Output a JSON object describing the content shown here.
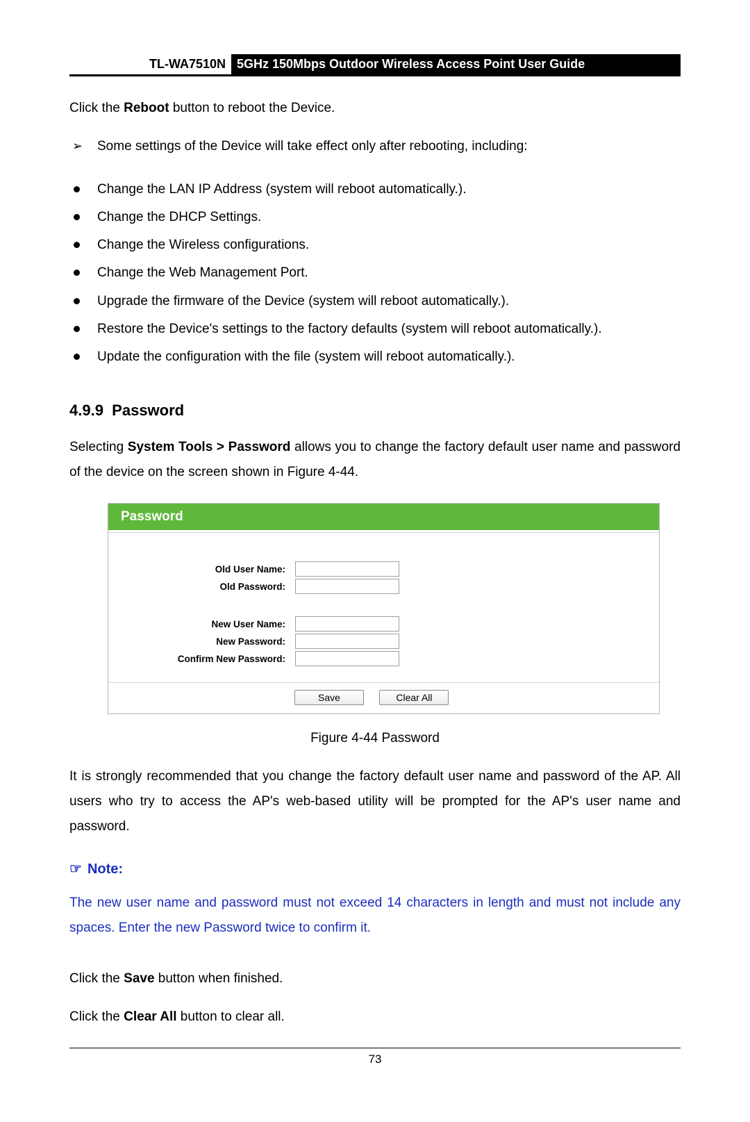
{
  "header": {
    "model": "TL-WA7510N",
    "title": "5GHz 150Mbps Outdoor Wireless Access Point User Guide"
  },
  "intro": {
    "pre": "Click the ",
    "bold": "Reboot",
    "post": " button to reboot the Device."
  },
  "arrow_item": "Some settings of the Device will take effect only after rebooting, including:",
  "bullets": [
    "Change the LAN IP Address (system will reboot automatically.).",
    "Change the DHCP Settings.",
    "Change the Wireless configurations.",
    "Change the Web Management Port.",
    "Upgrade the firmware of the Device (system will reboot automatically.).",
    "Restore the Device's settings to the factory defaults (system will reboot automatically.).",
    "Update the configuration with the file (system will reboot automatically.)."
  ],
  "section": {
    "number": "4.9.9",
    "title": "Password"
  },
  "section_intro": {
    "pre": "Selecting ",
    "bold": "System Tools > Password",
    "post": " allows you to change the factory default user name and password of the device on the screen shown in Figure 4-44."
  },
  "figure": {
    "title": "Password",
    "fields": {
      "old_user": "Old User Name:",
      "old_pass": "Old Password:",
      "new_user": "New User Name:",
      "new_pass": "New Password:",
      "confirm": "Confirm New Password:"
    },
    "buttons": {
      "save": "Save",
      "clear": "Clear All"
    },
    "caption": "Figure 4-44 Password"
  },
  "recommend": "It is strongly recommended that you change the factory default user name and password of the AP. All users who try to access the AP's web-based utility will be prompted for the AP's user name and password.",
  "note": {
    "heading": "Note:",
    "body": "The new user name and password must not exceed 14 characters in length and must not include any spaces. Enter the new Password twice to confirm it."
  },
  "closing": [
    {
      "pre": "Click the ",
      "bold": "Save",
      "post": " button when finished."
    },
    {
      "pre": "Click the ",
      "bold": "Clear All",
      "post": " button to clear all."
    }
  ],
  "page_number": "73"
}
